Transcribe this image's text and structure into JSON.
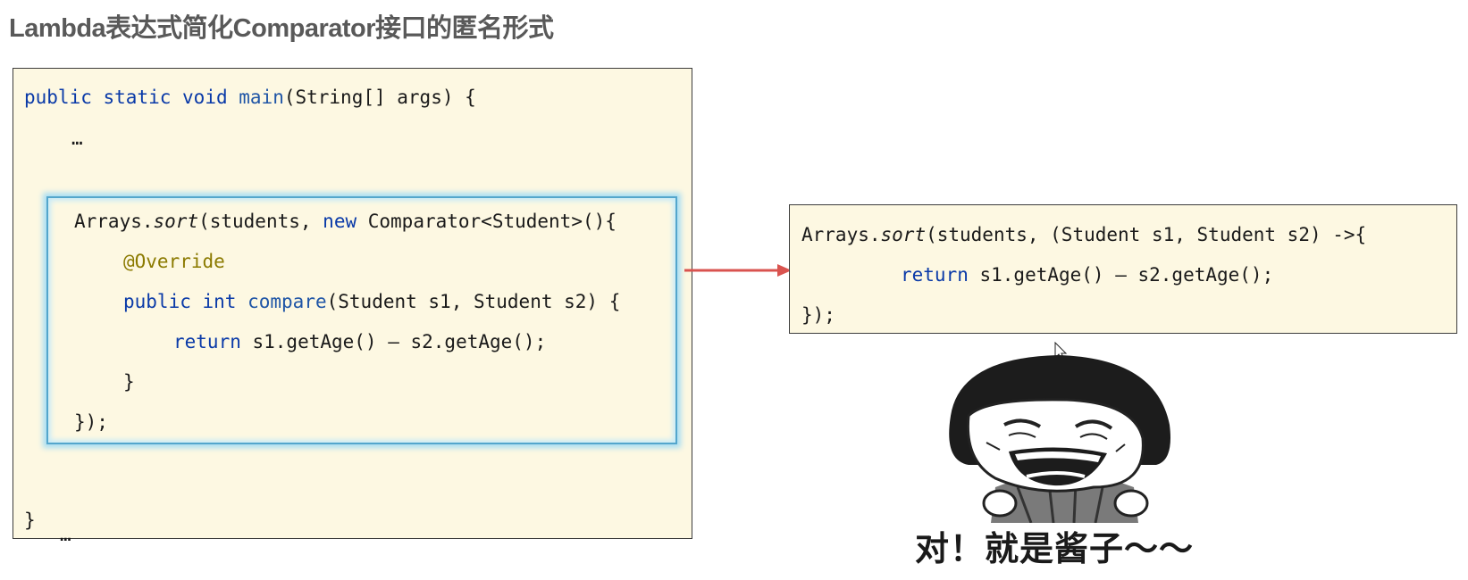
{
  "title": "Lambda表达式简化Comparator接口的匿名形式",
  "left_code": {
    "l1_kw1": "public",
    "l1_kw2": "static",
    "l1_kw3": "void",
    "l1_fn": "main",
    "l1_rest": "(String[] args) {",
    "l2": "…",
    "l3_a": "Arrays.",
    "l3_sort": "sort",
    "l3_b": "(students, ",
    "l3_new": "new",
    "l3_c": " Comparator<Student>(){",
    "l4_ann": "@Override",
    "l5_kw1": "public",
    "l5_kw2": "int",
    "l5_fn": "compare",
    "l5_rest": "(Student s1, Student s2) {",
    "l6_ret": "return",
    "l6_rest": " s1.getAge() – s2.getAge();",
    "l7": "}",
    "l8": "});",
    "l9": "…",
    "l10": "}"
  },
  "right_code": {
    "r1_a": "Arrays.",
    "r1_sort": "sort",
    "r1_b": "(students, (Student s1, Student s2) ->{",
    "r2_ret": "return",
    "r2_rest": " s1.getAge() – s2.getAge();",
    "r3": "});"
  },
  "caption": "对！就是酱子～～",
  "colors": {
    "panel_bg": "#fdf8e2",
    "keyword": "#0a3aa8",
    "annotation": "#8b7a00",
    "highlight_border": "#54a6cc",
    "arrow": "#d9534f"
  }
}
